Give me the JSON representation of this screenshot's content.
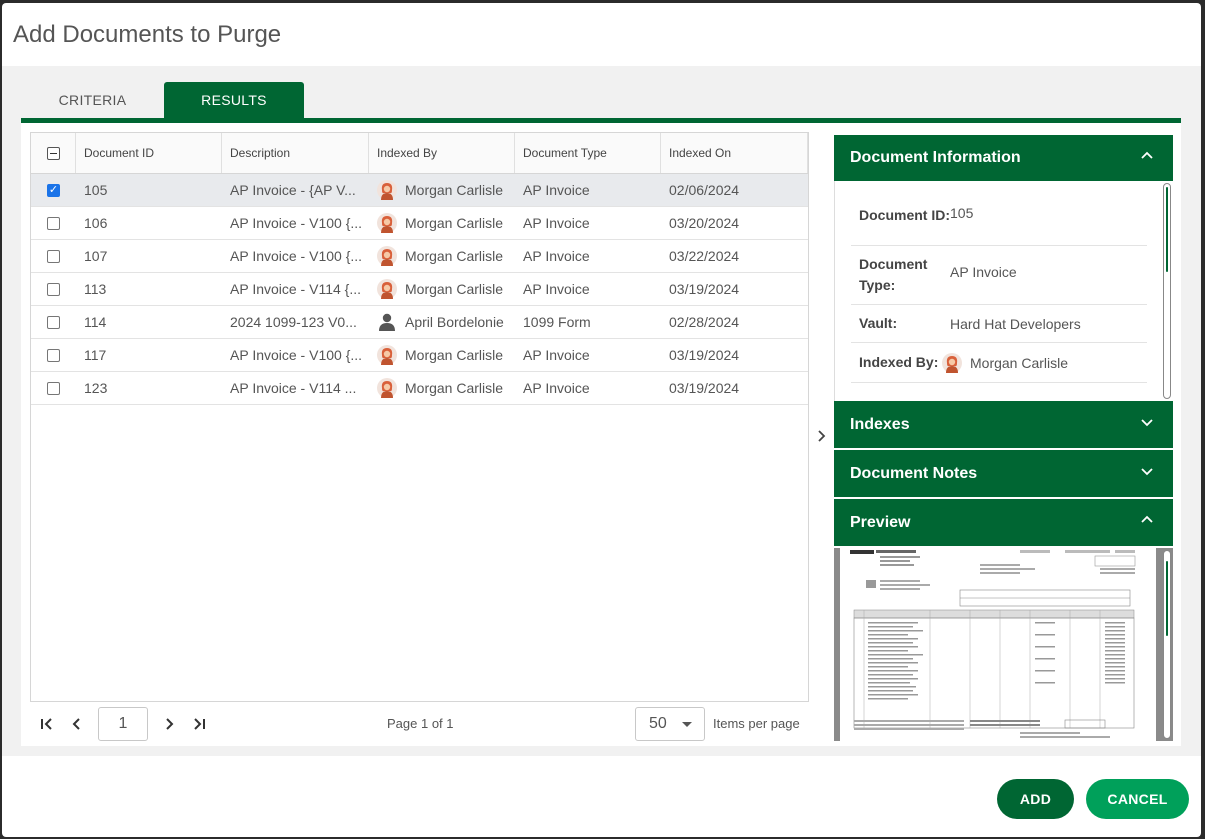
{
  "dialog": {
    "title": "Add Documents to Purge"
  },
  "tabs": [
    {
      "label": "CRITERIA",
      "active": false
    },
    {
      "label": "RESULTS",
      "active": true
    }
  ],
  "grid": {
    "columns": [
      "Document ID",
      "Description",
      "Indexed By",
      "Document Type",
      "Indexed On"
    ],
    "rows": [
      {
        "checked": true,
        "id": "105",
        "description": "AP Invoice - {AP V...",
        "indexed_by": "Morgan Carlisle",
        "avatar": "female-avatar",
        "type": "AP Invoice",
        "indexed_on": "02/06/2024"
      },
      {
        "checked": false,
        "id": "106",
        "description": "AP Invoice - V100 {...",
        "indexed_by": "Morgan Carlisle",
        "avatar": "female-avatar",
        "type": "AP Invoice",
        "indexed_on": "03/20/2024"
      },
      {
        "checked": false,
        "id": "107",
        "description": "AP Invoice - V100 {...",
        "indexed_by": "Morgan Carlisle",
        "avatar": "female-avatar",
        "type": "AP Invoice",
        "indexed_on": "03/22/2024"
      },
      {
        "checked": false,
        "id": "113",
        "description": "AP Invoice - V114 {...",
        "indexed_by": "Morgan Carlisle",
        "avatar": "female-avatar",
        "type": "AP Invoice",
        "indexed_on": "03/19/2024"
      },
      {
        "checked": false,
        "id": "114",
        "description": "2024 1099-123 V0...",
        "indexed_by": "April Bordelonie",
        "avatar": "user-icon",
        "type": "1099 Form",
        "indexed_on": "02/28/2024"
      },
      {
        "checked": false,
        "id": "117",
        "description": "AP Invoice - V100 {...",
        "indexed_by": "Morgan Carlisle",
        "avatar": "female-avatar",
        "type": "AP Invoice",
        "indexed_on": "03/19/2024"
      },
      {
        "checked": false,
        "id": "123",
        "description": "AP Invoice - V114 ...",
        "indexed_by": "Morgan Carlisle",
        "avatar": "female-avatar",
        "type": "AP Invoice",
        "indexed_on": "03/19/2024"
      }
    ]
  },
  "pager": {
    "page": "1",
    "info": "Page 1 of 1",
    "page_size": "50",
    "page_size_label": "Items per page"
  },
  "side": {
    "doc_info": {
      "title": "Document Information",
      "expanded": true,
      "fields": [
        {
          "label": "Document ID:",
          "value": "105"
        },
        {
          "label": "Document Type:",
          "value": "AP Invoice"
        },
        {
          "label": "Vault:",
          "value": "Hard Hat Developers"
        },
        {
          "label": "Indexed By:",
          "value": "Morgan Carlisle"
        }
      ]
    },
    "indexes": {
      "title": "Indexes",
      "expanded": false
    },
    "notes": {
      "title": "Document Notes",
      "expanded": false
    },
    "preview": {
      "title": "Preview",
      "expanded": true
    }
  },
  "buttons": {
    "add": "ADD",
    "cancel": "CANCEL"
  },
  "colors": {
    "brand": "#006633",
    "cancel": "#00a05a",
    "checkbox": "#1a73e8"
  }
}
